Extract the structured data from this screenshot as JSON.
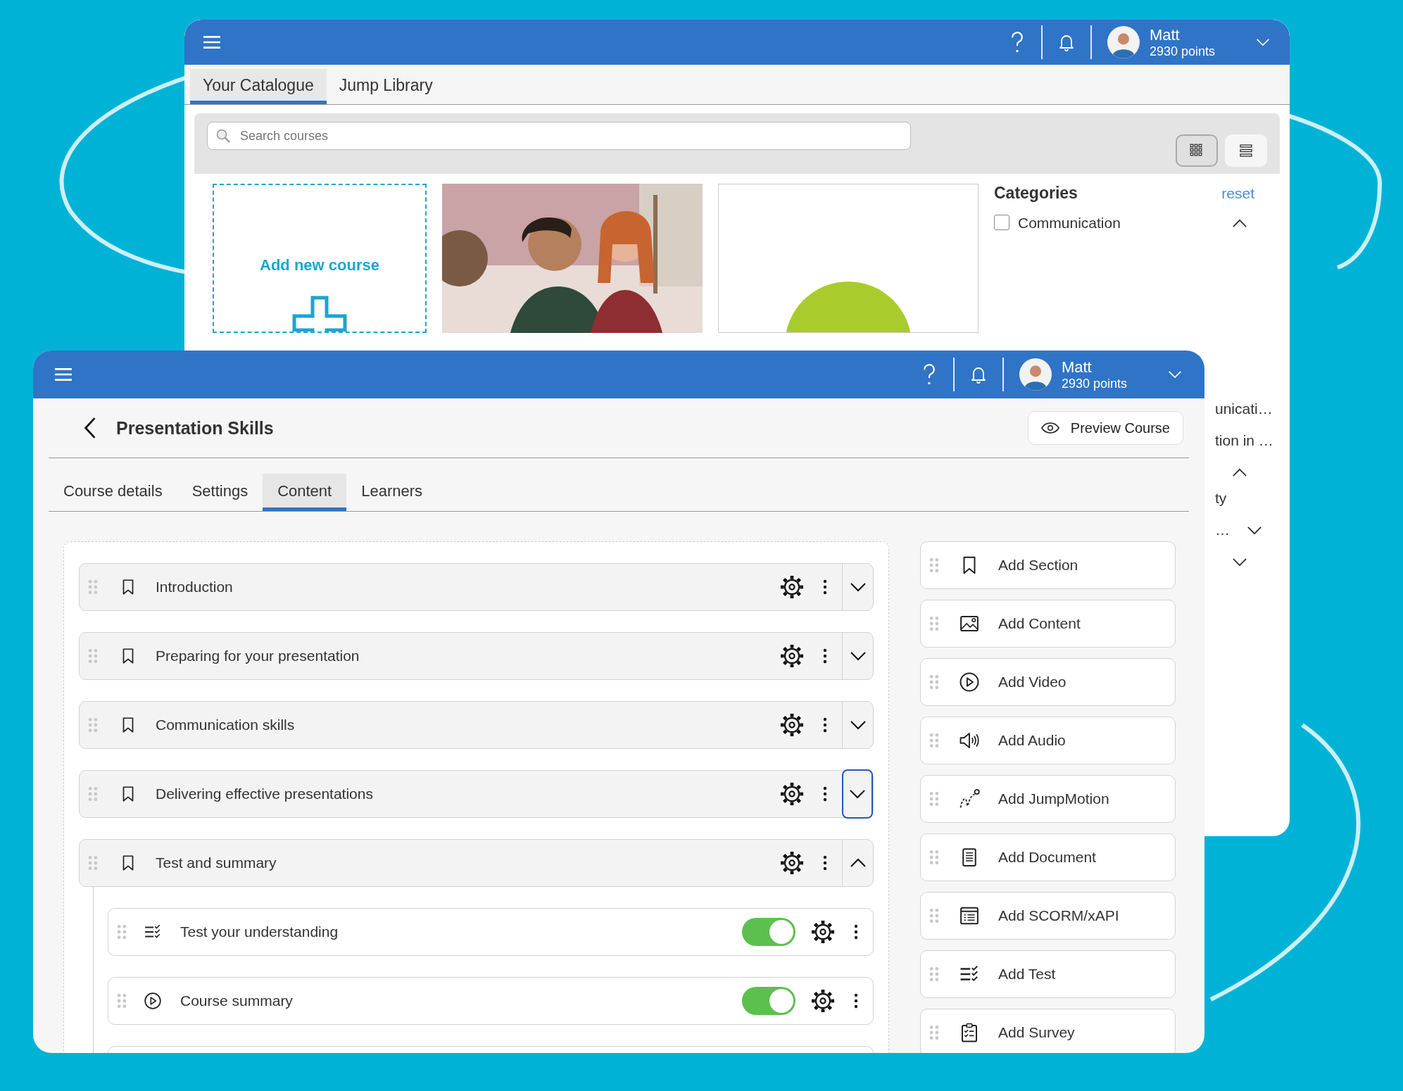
{
  "back_window": {
    "tabs": [
      {
        "label": "Your Catalogue",
        "selected": true
      },
      {
        "label": "Jump Library",
        "selected": false
      }
    ],
    "user": {
      "name": "Matt",
      "points": "2930 points"
    },
    "search": {
      "placeholder": "Search courses"
    },
    "view_toggle": [
      {
        "kind": "grid",
        "selected": true
      },
      {
        "kind": "list",
        "selected": false
      }
    ],
    "add_course": "Add new course",
    "cards": [
      {
        "kind": "picture"
      },
      {
        "kind": "circle"
      }
    ],
    "categories": {
      "title": "Categories",
      "reset": "reset",
      "rows": [
        {
          "kind": "filter",
          "label": "Communication",
          "checked": false,
          "expanded": true
        },
        {
          "kind": "fragment",
          "label": "unicati…"
        },
        {
          "kind": "fragment",
          "label": "tion in …"
        },
        {
          "kind": "toggle",
          "expanded": true
        },
        {
          "kind": "fragment",
          "label": "ty"
        },
        {
          "kind": "fragment",
          "label": "…",
          "expanded": false
        },
        {
          "kind": "toggle",
          "expanded": false
        }
      ]
    }
  },
  "front_window": {
    "user": {
      "name": "Matt",
      "points": "2930 points"
    },
    "title": "Presentation Skills",
    "preview_button": "Preview Course",
    "tabs": [
      {
        "label": "Course details",
        "selected": false
      },
      {
        "label": "Settings",
        "selected": false
      },
      {
        "label": "Content",
        "selected": true
      },
      {
        "label": "Learners",
        "selected": false
      }
    ],
    "sections": [
      {
        "title": "Introduction",
        "expanded": false,
        "focused": false
      },
      {
        "title": "Preparing for your presentation",
        "expanded": false,
        "focused": false
      },
      {
        "title": "Communication skills",
        "expanded": false,
        "focused": false
      },
      {
        "title": "Delivering effective presentations",
        "expanded": false,
        "focused": true
      },
      {
        "title": "Test and summary",
        "expanded": true,
        "focused": false,
        "children": [
          {
            "title": "Test your understanding",
            "kind": "test",
            "on": true
          },
          {
            "title": "Course summary",
            "kind": "video",
            "on": true
          }
        ]
      }
    ],
    "add_items": [
      {
        "label": "Add Section",
        "kind": "section"
      },
      {
        "label": "Add Content",
        "kind": "content"
      },
      {
        "label": "Add Video",
        "kind": "video"
      },
      {
        "label": "Add Audio",
        "kind": "audio"
      },
      {
        "label": "Add JumpMotion",
        "kind": "jumpmotion"
      },
      {
        "label": "Add Document",
        "kind": "document"
      },
      {
        "label": "Add SCORM/xAPI",
        "kind": "scorm"
      },
      {
        "label": "Add Test",
        "kind": "test"
      },
      {
        "label": "Add Survey",
        "kind": "survey"
      }
    ]
  }
}
